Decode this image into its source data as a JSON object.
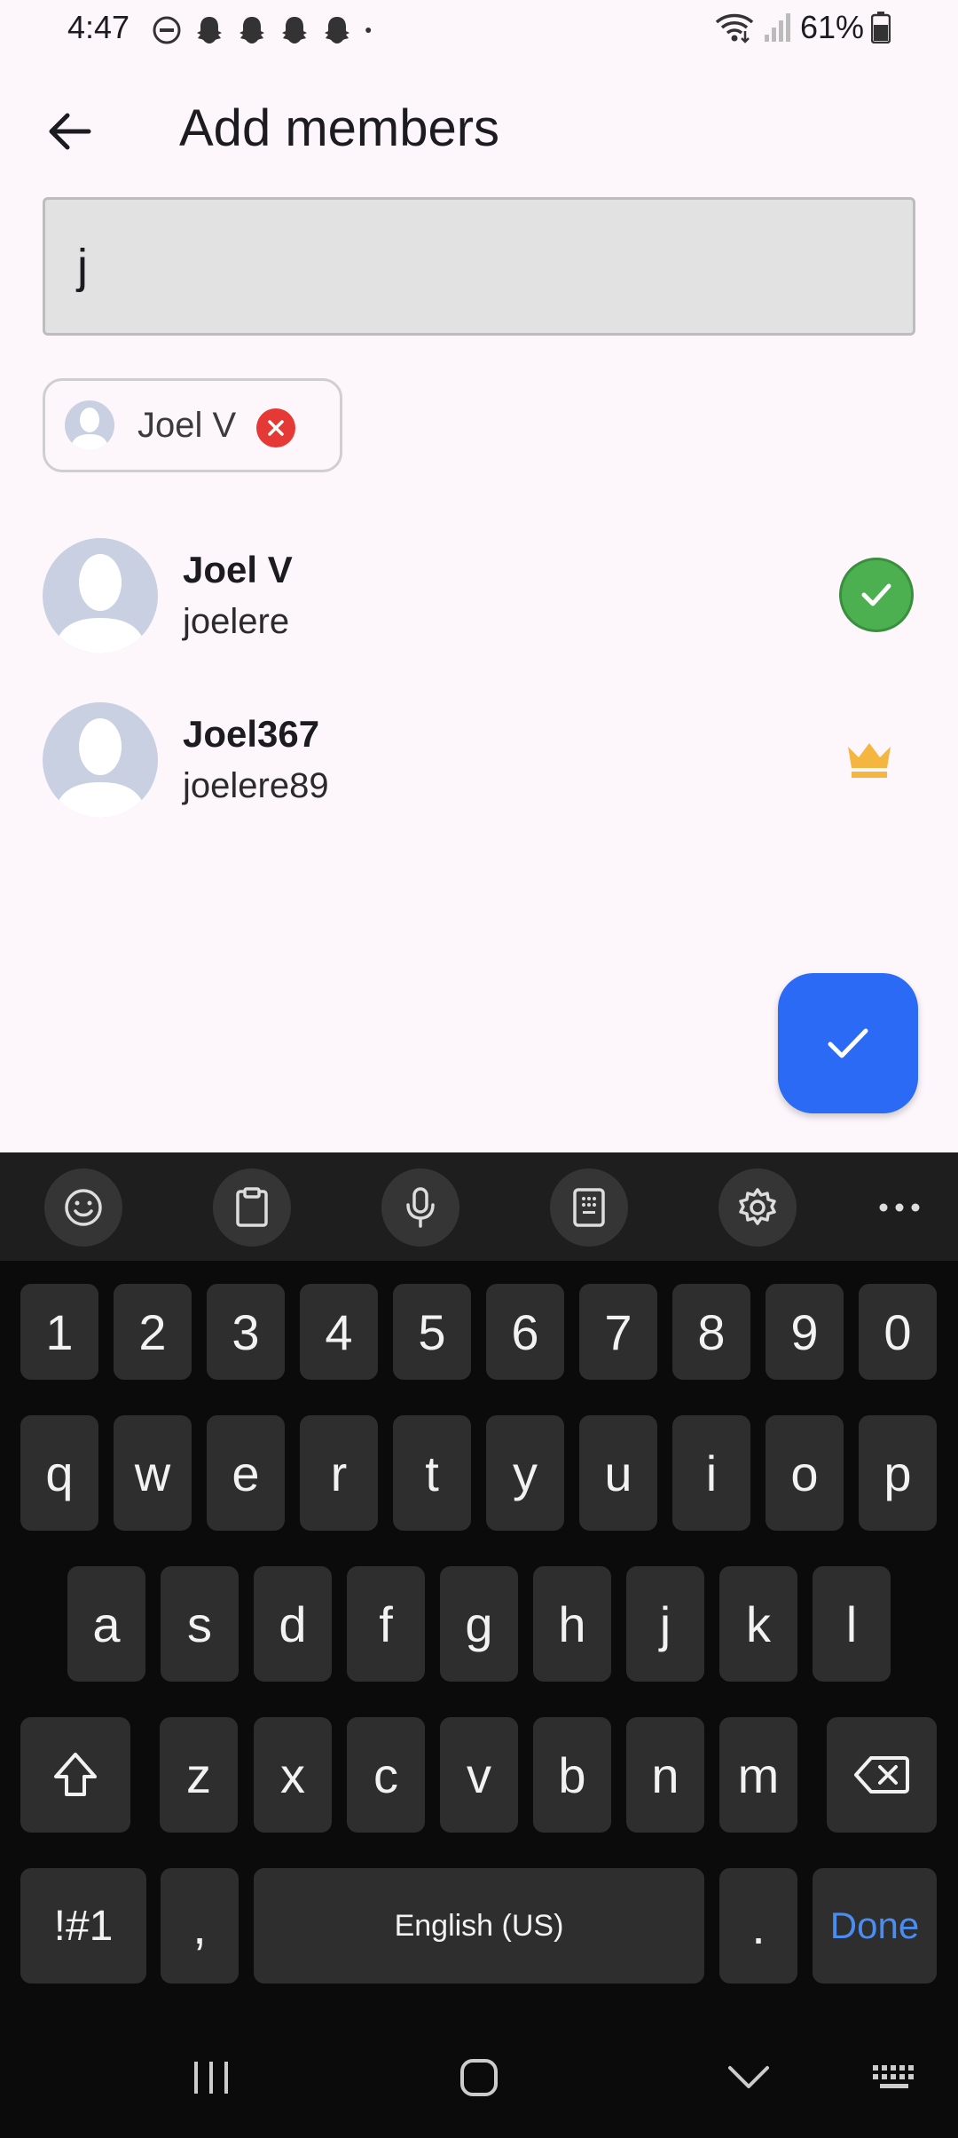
{
  "status": {
    "time": "4:47",
    "battery": "61%",
    "icons": [
      "dnd-icon",
      "snapchat-icon",
      "snapchat-icon",
      "snapchat-icon",
      "snapchat-icon",
      "dot-icon"
    ]
  },
  "header": {
    "title": "Add members"
  },
  "search": {
    "value": "j"
  },
  "selected_chips": [
    {
      "label": "Joel V"
    }
  ],
  "results": [
    {
      "name": "Joel V",
      "username": "joelere",
      "state": "selected"
    },
    {
      "name": "Joel367",
      "username": "joelere89",
      "state": "owner"
    }
  ],
  "keyboard": {
    "number_row": [
      "1",
      "2",
      "3",
      "4",
      "5",
      "6",
      "7",
      "8",
      "9",
      "0"
    ],
    "row1": [
      "q",
      "w",
      "e",
      "r",
      "t",
      "y",
      "u",
      "i",
      "o",
      "p"
    ],
    "row2": [
      "a",
      "s",
      "d",
      "f",
      "g",
      "h",
      "j",
      "k",
      "l"
    ],
    "row3": [
      "z",
      "x",
      "c",
      "v",
      "b",
      "n",
      "m"
    ],
    "symbols_label": "!#1",
    "comma": ",",
    "space_label": "English (US)",
    "period": ".",
    "done_label": "Done"
  },
  "colors": {
    "accent": "#2a6af5",
    "check": "#4caf50",
    "remove": "#e53935",
    "crown": "#f4b63f"
  }
}
